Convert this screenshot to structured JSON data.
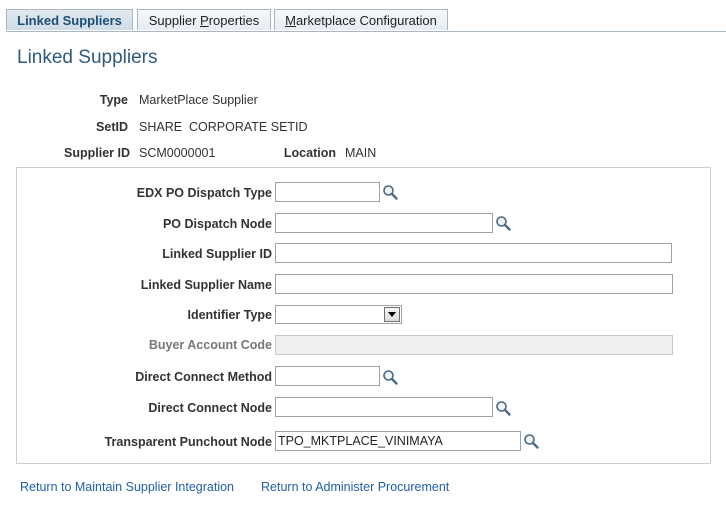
{
  "tabs": [
    {
      "label": "Linked Suppliers",
      "active": true
    },
    {
      "label_pre": "Supplier ",
      "label_ul": "P",
      "label_post": "roperties",
      "active": false
    },
    {
      "label_pre": "",
      "label_ul": "M",
      "label_post": "arketplace Configuration",
      "active": false
    }
  ],
  "page": {
    "title": "Linked Suppliers"
  },
  "header": {
    "type_label": "Type",
    "type_value": "MarketPlace Supplier",
    "setid_label": "SetID",
    "setid_value": "SHARE  CORPORATE SETID",
    "supplier_id_label": "Supplier ID",
    "supplier_id_value": "SCM0000001",
    "location_label": "Location",
    "location_value": "MAIN"
  },
  "form": {
    "edx_po_dispatch_type": {
      "label": "EDX PO Dispatch Type",
      "value": ""
    },
    "po_dispatch_node": {
      "label": "PO Dispatch Node",
      "value": ""
    },
    "linked_supplier_id": {
      "label": "Linked Supplier ID",
      "value": ""
    },
    "linked_supplier_name": {
      "label": "Linked Supplier Name",
      "value": ""
    },
    "identifier_type": {
      "label": "Identifier Type",
      "value": ""
    },
    "buyer_account_code": {
      "label": "Buyer Account Code",
      "value": ""
    },
    "direct_connect_method": {
      "label": "Direct Connect Method",
      "value": ""
    },
    "direct_connect_node": {
      "label": "Direct Connect Node",
      "value": ""
    },
    "transparent_punchout_node": {
      "label": "Transparent Punchout Node",
      "value": "TPO_MKTPLACE_VINIMAYA"
    }
  },
  "links": {
    "return_integration": "Return to Maintain Supplier Integration",
    "return_procurement": "Return to Administer Procurement"
  },
  "icons": {
    "lookup": "magnifier-icon",
    "dropdown": "chevron-down-icon"
  },
  "colors": {
    "title": "#2f5a7f",
    "link": "#2160a8",
    "tab_active_text": "#1b4f78"
  }
}
